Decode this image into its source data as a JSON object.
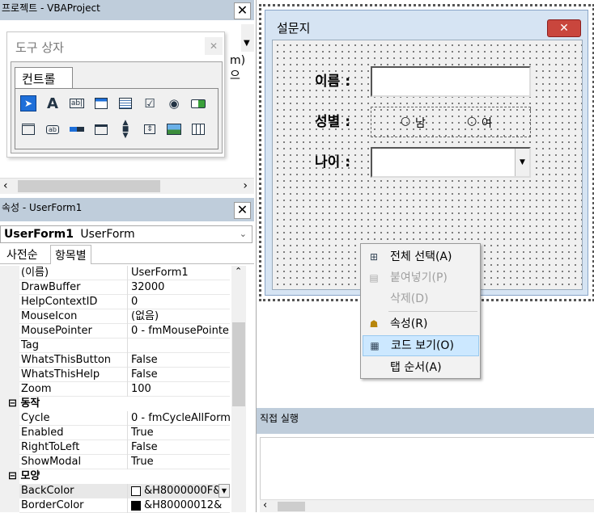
{
  "project_panel": {
    "title": "프로젝트 - VBAProject",
    "partial_text": "m)으"
  },
  "toolbox": {
    "title": "도구 상자",
    "tab": "컨트롤",
    "tools_row1": [
      "select-pointer-icon",
      "label-icon",
      "textbox-icon",
      "combobox-icon",
      "listbox-icon",
      "checkbox-icon",
      "optionbutton-icon",
      "togglebutton-icon"
    ],
    "tools_row2": [
      "frame-icon",
      "commandbutton-icon",
      "tabstrip-icon",
      "multipage-icon",
      "scrollbar-icon",
      "spinbutton-icon",
      "image-icon",
      "refedit-icon"
    ]
  },
  "properties_panel": {
    "title": "속성 - UserForm1",
    "object_name": "UserForm1",
    "object_type": "UserForm",
    "tabs": [
      "사전순",
      "항목별"
    ],
    "rows_top": [
      {
        "key": "(이름)",
        "value": "UserForm1"
      },
      {
        "key": "DrawBuffer",
        "value": "32000"
      },
      {
        "key": "HelpContextID",
        "value": "0"
      },
      {
        "key": "MouseIcon",
        "value": "(없음)"
      },
      {
        "key": "MousePointer",
        "value": "0 - fmMousePointe"
      },
      {
        "key": "Tag",
        "value": ""
      },
      {
        "key": "WhatsThisButton",
        "value": "False"
      },
      {
        "key": "WhatsThisHelp",
        "value": "False"
      },
      {
        "key": "Zoom",
        "value": "100"
      }
    ],
    "category_1": "동작",
    "rows_mid": [
      {
        "key": "Cycle",
        "value": "0 - fmCycleAllForm"
      },
      {
        "key": "Enabled",
        "value": "True"
      },
      {
        "key": "RightToLeft",
        "value": "False"
      },
      {
        "key": "ShowModal",
        "value": "True"
      }
    ],
    "category_2": "모양",
    "rows_bottom": [
      {
        "key": "BackColor",
        "value": "&H8000000F&"
      },
      {
        "key": "BorderColor",
        "value": "&H80000012&"
      }
    ],
    "collapse_sign": "⊟"
  },
  "form": {
    "title": "설문지",
    "name_label": "이름 :",
    "gender_label": "성별 :",
    "male": "남",
    "female": "여",
    "age_label": "나이 :"
  },
  "context_menu": {
    "items": [
      {
        "label": "전체 선택(A)",
        "enabled": true
      },
      {
        "label": "붙여넣기(P)",
        "enabled": false
      },
      {
        "label": "삭제(D)",
        "enabled": false
      },
      {
        "label": "속성(R)",
        "enabled": true
      },
      {
        "label": "코드 보기(O)",
        "enabled": true,
        "highlighted": true
      },
      {
        "label": "탭 순서(A)",
        "enabled": true
      }
    ]
  },
  "immediate_panel": {
    "title": "직접 실행"
  },
  "colors": {
    "panel_title_bg": "#bfcddb",
    "form_title_bg": "#d6e4f3",
    "highlight": "#cce8ff",
    "close_red": "#c9463d"
  }
}
